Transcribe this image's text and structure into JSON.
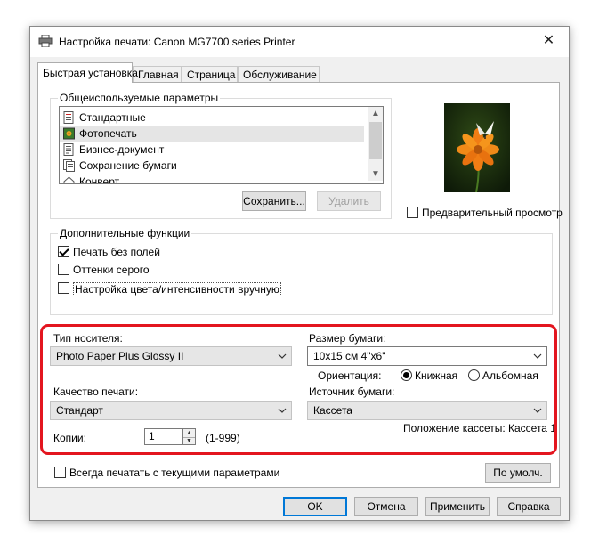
{
  "window": {
    "title": "Настройка печати: Canon MG7700 series Printer",
    "close_glyph": "✕"
  },
  "tabs": [
    {
      "label": "Быстрая установка",
      "active": true
    },
    {
      "label": "Главная",
      "active": false
    },
    {
      "label": "Страница",
      "active": false
    },
    {
      "label": "Обслуживание",
      "active": false
    }
  ],
  "common_settings": {
    "group_label": "Общеиспользуемые параметры",
    "items": [
      {
        "label": "Стандартные",
        "icon": "standard-doc-icon",
        "selected": false
      },
      {
        "label": "Фотопечать",
        "icon": "photo-print-icon",
        "selected": true
      },
      {
        "label": "Бизнес-документ",
        "icon": "business-doc-icon",
        "selected": false
      },
      {
        "label": "Сохранение бумаги",
        "icon": "paper-saving-icon",
        "selected": false
      },
      {
        "label": "Конверт",
        "icon": "envelope-icon",
        "selected": false
      }
    ],
    "save_button": "Сохранить...",
    "delete_button": "Удалить"
  },
  "preview": {
    "checkbox_label": "Предварительный просмотр",
    "checked": false,
    "image": "flower-butterfly-photo"
  },
  "additional": {
    "group_label": "Дополнительные функции",
    "options": [
      {
        "label": "Печать без полей",
        "checked": true
      },
      {
        "label": "Оттенки серого",
        "checked": false
      },
      {
        "label": "Настройка цвета/интенсивности вручную",
        "checked": false
      }
    ]
  },
  "media": {
    "media_type_label": "Тип носителя:",
    "media_type_value": "Photo Paper Plus Glossy II",
    "paper_size_label": "Размер бумаги:",
    "paper_size_value": "10x15 см 4\"x6\"",
    "orientation_label": "Ориентация:",
    "orientation_portrait": "Книжная",
    "orientation_landscape": "Альбомная",
    "orientation_selected": "portrait",
    "quality_label": "Качество печати:",
    "quality_value": "Стандарт",
    "source_label": "Источник бумаги:",
    "source_value": "Кассета",
    "cassette_position": "Положение кассеты: Кассета 1",
    "copies_label": "Копии:",
    "copies_value": "1",
    "copies_range": "(1-999)",
    "highlight_color": "#e3151f"
  },
  "always_print": {
    "label": "Всегда печатать с текущими параметрами",
    "checked": false
  },
  "defaults_button": "По умолч.",
  "footer": {
    "ok": "OK",
    "cancel": "Отмена",
    "apply": "Применить",
    "help": "Справка"
  },
  "colors": {
    "dialog_bg": "#f0f0f0",
    "accent": "#0078d7",
    "selected_item": "#e5e5e5"
  }
}
